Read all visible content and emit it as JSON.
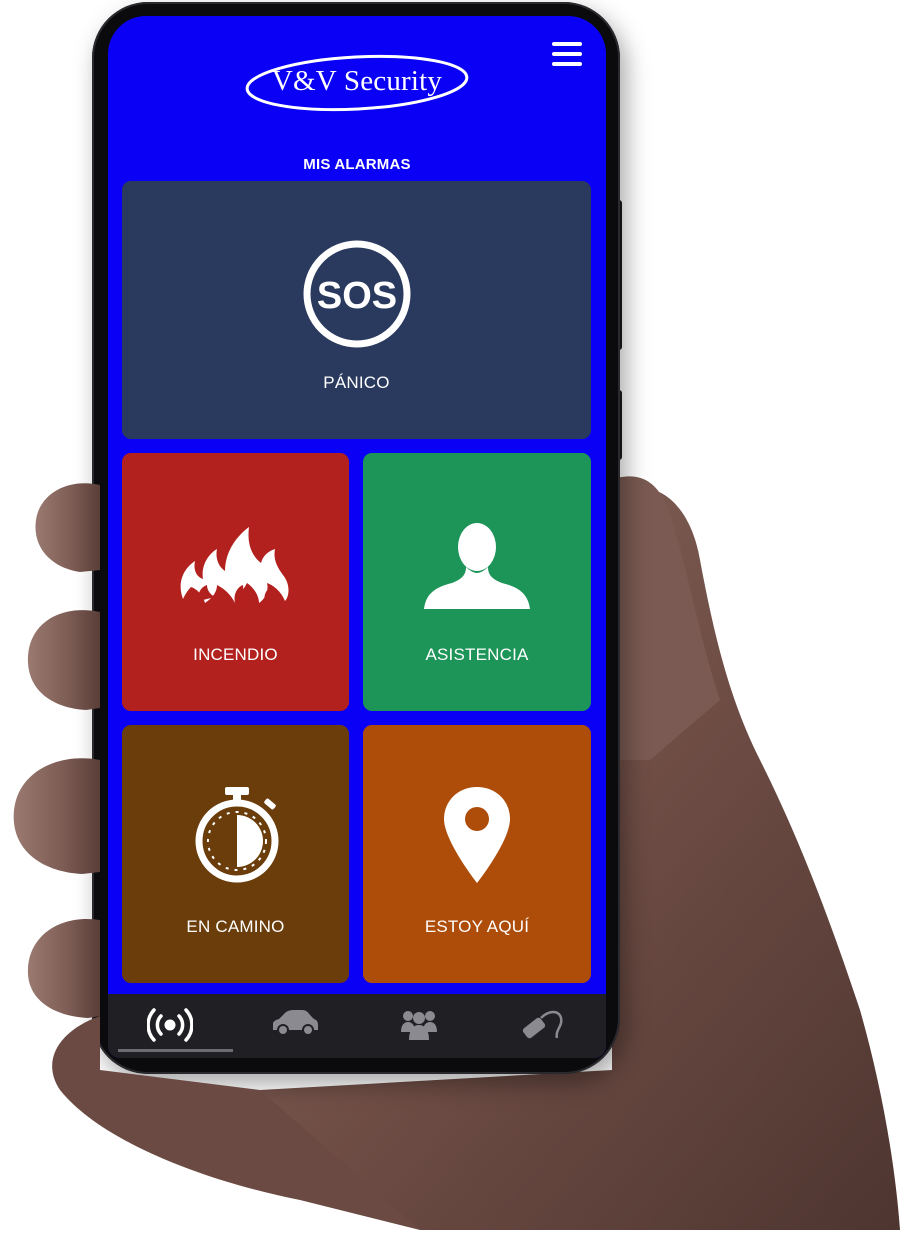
{
  "app": {
    "logo_text": "V&V Security",
    "section_title": "MIS ALARMAS"
  },
  "alarms": [
    {
      "id": "panic",
      "label": "PÁNICO",
      "icon": "sos-icon",
      "color": "#2a3a5e"
    },
    {
      "id": "fire",
      "label": "INCENDIO",
      "icon": "flames-icon",
      "color": "#b3211e"
    },
    {
      "id": "assistance",
      "label": "ASISTENCIA",
      "icon": "person-icon",
      "color": "#1d9458"
    },
    {
      "id": "on-the-way",
      "label": "EN CAMINO",
      "icon": "stopwatch-icon",
      "color": "#6a3d0b"
    },
    {
      "id": "here",
      "label": "ESTOY AQUÍ",
      "icon": "map-pin-icon",
      "color": "#ae4d0a"
    }
  ],
  "sos_text": "SOS",
  "bottom_nav": [
    {
      "icon": "alarm-broadcast-icon",
      "active": true
    },
    {
      "icon": "car-icon",
      "active": false
    },
    {
      "icon": "group-icon",
      "active": false
    },
    {
      "icon": "remote-key-icon",
      "active": false
    }
  ],
  "colors": {
    "screen_background": "#0a00f5",
    "nav_background": "#202024"
  }
}
